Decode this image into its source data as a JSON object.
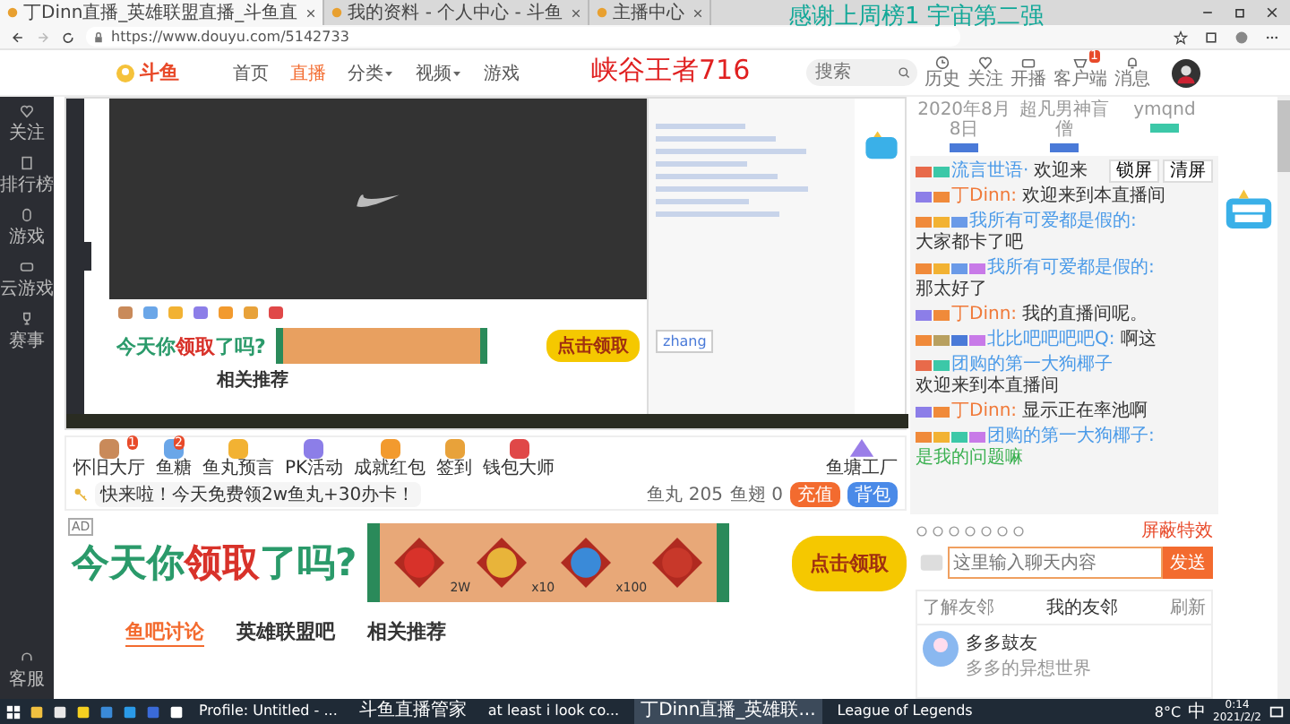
{
  "browser": {
    "tabs": [
      {
        "title": "丁Dinn直播_英雄联盟直播_斗鱼直",
        "selected": true
      },
      {
        "title": "我的资料 - 个人中心 - 斗鱼",
        "selected": false
      },
      {
        "title": "主播中心",
        "selected": false
      }
    ],
    "url": "https://www.douyu.com/5142733"
  },
  "overlay": {
    "line_1": "感谢上周榜1 宇宙第二强",
    "line_2": "峡谷王者716"
  },
  "header": {
    "logo": "斗鱼",
    "nav": [
      {
        "label": "首页",
        "selected": false,
        "dropdown": false
      },
      {
        "label": "直播",
        "selected": true,
        "dropdown": false
      },
      {
        "label": "分类",
        "selected": false,
        "dropdown": true
      },
      {
        "label": "视频",
        "selected": false,
        "dropdown": true
      },
      {
        "label": "游戏",
        "selected": false,
        "dropdown": false
      }
    ],
    "search": {
      "placeholder": "搜索"
    },
    "actions": [
      {
        "kind": "history",
        "label": "历史"
      },
      {
        "kind": "heart",
        "label": "关注"
      },
      {
        "kind": "camera",
        "label": "开播"
      },
      {
        "kind": "client",
        "label": "客户端",
        "badge": "1"
      },
      {
        "kind": "bell",
        "label": "消息"
      }
    ]
  },
  "sidebar": {
    "items": [
      {
        "kind": "heart",
        "label": "关注"
      },
      {
        "kind": "list",
        "label": "排行榜"
      },
      {
        "kind": "mouse",
        "label": "游戏"
      },
      {
        "kind": "pad",
        "label": "云游戏"
      },
      {
        "kind": "trophy",
        "label": "赛事"
      }
    ],
    "bottom": {
      "kind": "headset",
      "label": "客服"
    }
  },
  "embedded": {
    "ad": {
      "parts": [
        {
          "text": "今天你",
          "emphasis": false
        },
        {
          "text": "领取",
          "emphasis": true
        },
        {
          "text": "了吗?",
          "emphasis": false
        }
      ],
      "button": "点击领取"
    },
    "related": "相关推荐",
    "ime_input": "zhang"
  },
  "gifts": {
    "items": [
      {
        "label": "怀旧大厅",
        "badge": "1",
        "color": "#c98a5a"
      },
      {
        "label": "鱼糖",
        "badge": "2",
        "color": "#6aa6e8"
      },
      {
        "label": "鱼丸预言",
        "color": "#f2b233"
      },
      {
        "label": "PK活动",
        "color": "#8c7ee8"
      },
      {
        "label": "成就红包",
        "color": "#f29a2e"
      },
      {
        "label": "签到",
        "color": "#e8a23a"
      },
      {
        "label": "钱包大师",
        "color": "#e04848"
      }
    ],
    "notice": "快来啦！今天免费领2w鱼丸+30办卡！",
    "factory": "鱼塘工厂",
    "yuwan": "鱼丸 205",
    "yuchi": "鱼翅 0",
    "recharge": "充值",
    "backpack": "背包"
  },
  "ad": {
    "tag": "AD",
    "parts": [
      {
        "text": "今天你",
        "emphasis": false
      },
      {
        "text": "领取",
        "emphasis": true
      },
      {
        "text": "了吗?",
        "emphasis": false
      }
    ],
    "rewards": [
      {
        "amount": "2W",
        "color": "#d8322a"
      },
      {
        "amount": "x10",
        "color": "#e8b43a"
      },
      {
        "amount": "x100",
        "color": "#3a8ad8"
      },
      {
        "color": "#c8382a"
      }
    ],
    "button": "点击领取"
  },
  "tabs": [
    {
      "label": "鱼吧讨论",
      "selected": true
    },
    {
      "label": "英雄联盟吧",
      "selected": false
    },
    {
      "label": "相关推荐",
      "selected": false
    }
  ],
  "rank": [
    {
      "name": "2020年8月8日",
      "color": "#4a7ad8"
    },
    {
      "name": "超凡男神盲僧",
      "color": "#4a7ad8"
    },
    {
      "name": "ymqnd",
      "color": "#3cc8a8"
    }
  ],
  "chat": {
    "lock": "锁屏",
    "clear": "清屏",
    "messages": [
      {
        "badges": [
          {
            "color": "#e86a4a"
          },
          {
            "color": "#3cc8a8"
          }
        ],
        "user": {
          "name": "流言世语·",
          "color": "#4a9ae8"
        },
        "text": "欢迎来",
        "highlight": false
      },
      {
        "badges": [
          {
            "color": "#8c7ee8"
          },
          {
            "color": "#f08a3a"
          }
        ],
        "user": {
          "name": "丁Dinn:",
          "color": "#f07a3a"
        },
        "text": "欢迎来到本直播间",
        "highlight": false
      },
      {
        "badges": [
          {
            "color": "#f08a3a"
          },
          {
            "color": "#f2b233"
          },
          {
            "color": "#6a9ae8"
          }
        ],
        "user": {
          "name": "我所有可爱都是假的:",
          "color": "#4a9ae8"
        },
        "text": "大家都卡了吧",
        "highlight": false
      },
      {
        "badges": [
          {
            "color": "#f08a3a"
          },
          {
            "color": "#f2b233"
          },
          {
            "color": "#6a9ae8"
          },
          {
            "color": "#c87ae8"
          }
        ],
        "user": {
          "name": "我所有可爱都是假的:",
          "color": "#4a9ae8"
        },
        "text": "那太好了",
        "highlight": false
      },
      {
        "badges": [
          {
            "color": "#8c7ee8"
          },
          {
            "color": "#f08a3a"
          }
        ],
        "user": {
          "name": "丁Dinn:",
          "color": "#f07a3a"
        },
        "text": "我的直播间呢。",
        "highlight": false
      },
      {
        "badges": [
          {
            "color": "#f08a3a"
          },
          {
            "color": "#b8a060"
          },
          {
            "color": "#4a7ad8"
          },
          {
            "color": "#c87ae8"
          }
        ],
        "user": {
          "name": "北比吧吧吧吧Q:",
          "color": "#4a9ae8"
        },
        "text": "啊这",
        "highlight": false
      },
      {
        "badges": [
          {
            "color": "#e86a4a"
          },
          {
            "color": "#3cc8a8"
          }
        ],
        "user": {
          "name": "团购的第一大狗椰子",
          "color": "#4a9ae8"
        },
        "text": "欢迎来到本直播间",
        "highlight": false
      },
      {
        "badges": [
          {
            "color": "#8c7ee8"
          },
          {
            "color": "#f08a3a"
          }
        ],
        "user": {
          "name": "丁Dinn:",
          "color": "#f07a3a"
        },
        "text": "显示正在率池啊",
        "highlight": false
      },
      {
        "badges": [
          {
            "color": "#f08a3a"
          },
          {
            "color": "#f2b233"
          },
          {
            "color": "#3cc8a8"
          },
          {
            "color": "#c87ae8"
          }
        ],
        "user": {
          "name": "团购的第一大狗椰子:",
          "color": "#4a9ae8"
        },
        "text": "是我的问题嘛",
        "highlight": true
      }
    ],
    "block_effects": "屏蔽特效",
    "input": {
      "placeholder": "这里输入聊天内容"
    },
    "send": "发送"
  },
  "friends": {
    "about": "了解友邻",
    "title": "我的友邻",
    "refresh": "刷新",
    "user": {
      "name": "多多鼓友",
      "bio": "多多的异想世界"
    }
  },
  "taskbar": {
    "apps": [
      {
        "label": "Profile: Untitled - ...",
        "active": false
      },
      {
        "label": "斗鱼直播管家",
        "active": false
      },
      {
        "label": "at least i look co...",
        "active": false
      },
      {
        "label": "丁Dinn直播_英雄联...",
        "active": true
      },
      {
        "label": "League of Legends",
        "active": false
      }
    ],
    "weather": "8°C",
    "ime": "中",
    "time": "0:14",
    "date": "2021/2/2"
  }
}
